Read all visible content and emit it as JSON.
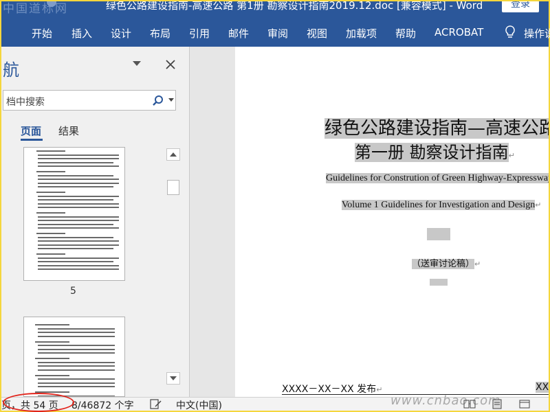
{
  "titlebar": {
    "title": "绿色公路建设指南-高速公路 第1册 勘察设计指南2019.12.doc [兼容模式] - Word",
    "signin_label": "登录",
    "watermark": "中国道标网"
  },
  "ribbon": {
    "tabs": [
      "开始",
      "插入",
      "设计",
      "布局",
      "引用",
      "邮件",
      "审阅",
      "视图",
      "加载项",
      "帮助",
      "ACROBAT"
    ],
    "tell_me": "操作说",
    "tell_me_icon": "lightbulb-icon"
  },
  "navpane": {
    "title": "航",
    "search_placeholder": "档中搜索",
    "tabs": {
      "pages": "页面",
      "results": "结果"
    },
    "thumbnail_label": "5"
  },
  "document": {
    "title_line1": "绿色公路建设指南—高速公路",
    "title_line2": "第一册  勘察设计指南",
    "english_line1": "Guidelines for Constrution of Green Highway-Expressway",
    "english_line2": "Volume 1 Guidelines for Investigation and Design",
    "draft_label": "（送审讨论稿）",
    "publish_line": "XXXX－XX－XX 发布",
    "right_fragment": "XXX"
  },
  "statusbar": {
    "page_info": "页，共 54 页",
    "word_count": "8/46872 个字",
    "language": "中文(中国)",
    "watermark": "www.cnbao.com"
  },
  "colors": {
    "ribbon_blue": "#2b579a",
    "highlight_gray": "#c8c8c8",
    "annotation_red": "#e2231a"
  }
}
